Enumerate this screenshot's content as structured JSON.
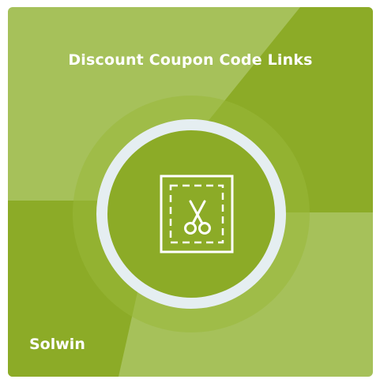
{
  "product": {
    "title": "Discount Coupon Code Links",
    "brand": "Solwin",
    "icon": "scissors-coupon-icon"
  },
  "colors": {
    "light_green": "#a6c15a",
    "dark_green": "#8cab27",
    "ring_glow": "#99b83b",
    "ring": "#e5eef1",
    "icon_stroke": "#ffffff"
  }
}
